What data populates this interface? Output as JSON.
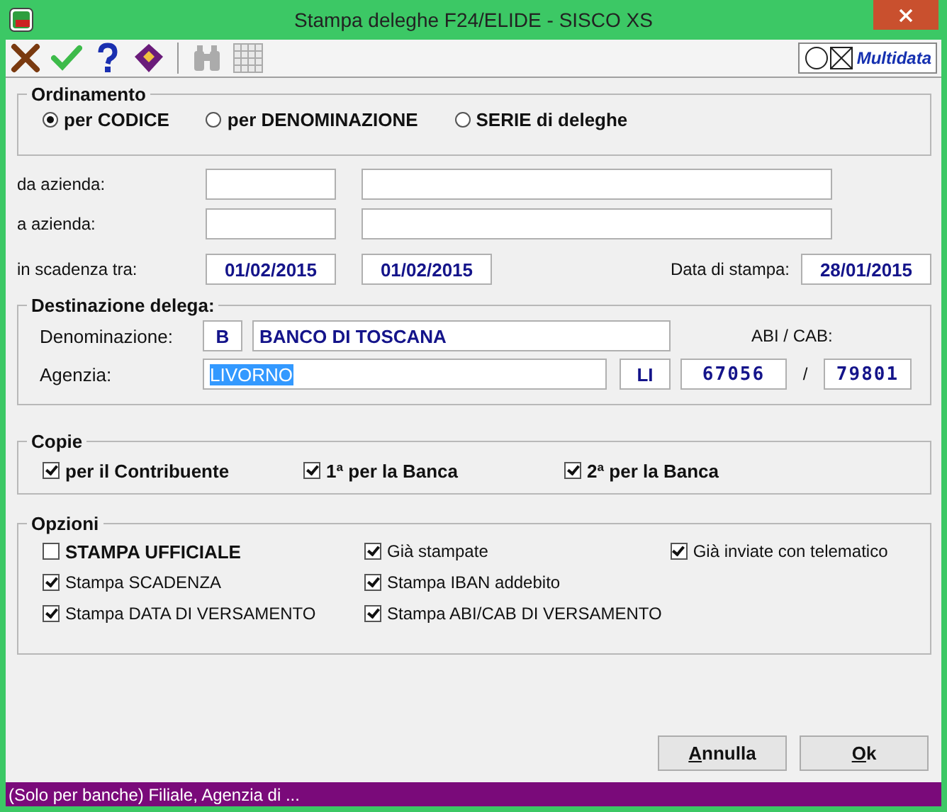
{
  "window": {
    "title": "Stampa deleghe F24/ELIDE - SISCO XS"
  },
  "toolbar": {
    "tools": [
      {
        "kind": "cancel",
        "disabled": false
      },
      {
        "kind": "confirm",
        "disabled": false
      },
      {
        "kind": "help",
        "disabled": false
      },
      {
        "kind": "book",
        "disabled": false
      },
      {
        "kind": "search",
        "disabled": true
      },
      {
        "kind": "grid",
        "disabled": true
      }
    ],
    "brand": "Multidata"
  },
  "ordinamento": {
    "title": "Ordinamento",
    "options": [
      {
        "label": "per CODICE",
        "selected": true
      },
      {
        "label": "per DENOMINAZIONE",
        "selected": false
      },
      {
        "label": "SERIE di deleghe",
        "selected": false
      }
    ]
  },
  "range": {
    "from_label": "da azienda:",
    "to_label": "a azienda:",
    "due_label": "in scadenza tra:",
    "due_from": "01/02/2015",
    "due_to": "01/02/2015",
    "print_date_label": "Data di stampa:",
    "print_date": "28/01/2015"
  },
  "destinazione": {
    "title": "Destinazione delega:",
    "name_label": "Denominazione:",
    "type": "B",
    "name": "BANCO DI TOSCANA",
    "abi_cab_label": "ABI / CAB:",
    "agency_label": "Agenzia:",
    "agency": "LIVORNO",
    "agency_highlighted": true,
    "province": "LI",
    "abi": "67056",
    "separator": "/",
    "cab": "79801"
  },
  "copie": {
    "title": "Copie",
    "items": [
      {
        "label": "per il Contribuente",
        "checked": true
      },
      {
        "label": "1ª per la Banca",
        "checked": true
      },
      {
        "label": "2ª per la Banca",
        "checked": true
      }
    ]
  },
  "opzioni": {
    "title": "Opzioni",
    "items": [
      {
        "label": "STAMPA UFFICIALE",
        "checked": false,
        "bold": true
      },
      {
        "label": "Già stampate",
        "checked": true,
        "bold": false
      },
      {
        "label": "Già inviate con telematico",
        "checked": true,
        "bold": false
      },
      {
        "label": "Stampa SCADENZA",
        "checked": true,
        "bold": false
      },
      {
        "label": "Stampa IBAN addebito",
        "checked": true,
        "bold": false
      },
      {
        "label": "Stampa DATA DI VERSAMENTO",
        "checked": true,
        "bold": false
      },
      {
        "label": "Stampa ABI/CAB DI VERSAMENTO",
        "checked": true,
        "bold": false
      }
    ]
  },
  "buttons": [
    "Annulla",
    "Ok"
  ],
  "status_bar": "(Solo per banche) Filiale, Agenzia di ..."
}
